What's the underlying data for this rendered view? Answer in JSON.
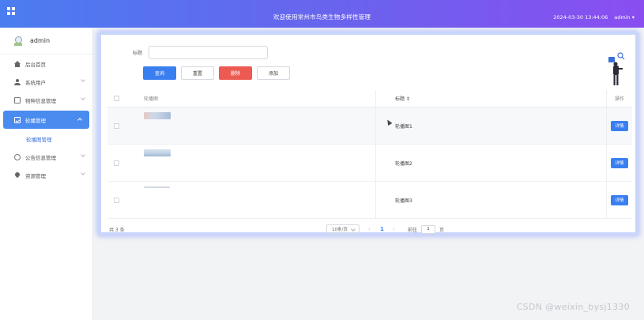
{
  "header": {
    "title": "欢迎使用常州市鸟类生物多样性管理",
    "datetime": "2024-03-30 13:44:06",
    "user": "admin"
  },
  "sidebar": {
    "profile_name": "admin",
    "items": [
      {
        "label": "后台首页",
        "icon": "home-icon"
      },
      {
        "label": "系统用户",
        "icon": "user-icon"
      },
      {
        "label": "物种信息管理",
        "icon": "document-icon"
      },
      {
        "label": "轮播管理",
        "icon": "chart-icon"
      },
      {
        "label": "公告信息管理",
        "icon": "info-icon"
      },
      {
        "label": "资源管理",
        "icon": "pin-icon"
      }
    ],
    "submenu": {
      "label": "轮播图管理"
    }
  },
  "search": {
    "label": "标题",
    "value": "",
    "placeholder": ""
  },
  "buttons": {
    "search": "查询",
    "reset": "重置",
    "delete": "删除",
    "add": "添加"
  },
  "table": {
    "headers": {
      "image": "轮播图",
      "title": "标题 ⇕",
      "op": "操作"
    },
    "rows": [
      {
        "title": "轮播图1",
        "detail": "详情"
      },
      {
        "title": "轮播图2",
        "detail": "详情"
      },
      {
        "title": "轮播图3",
        "detail": "详情"
      }
    ]
  },
  "pagination": {
    "total": "共 3 条",
    "page_size": "10条/页",
    "prev": "‹",
    "current": "1",
    "next": "›",
    "goto_label": "前往",
    "goto_value": "1",
    "goto_suffix": "页"
  },
  "watermark": "CSDN @weixin_bysj1330"
}
